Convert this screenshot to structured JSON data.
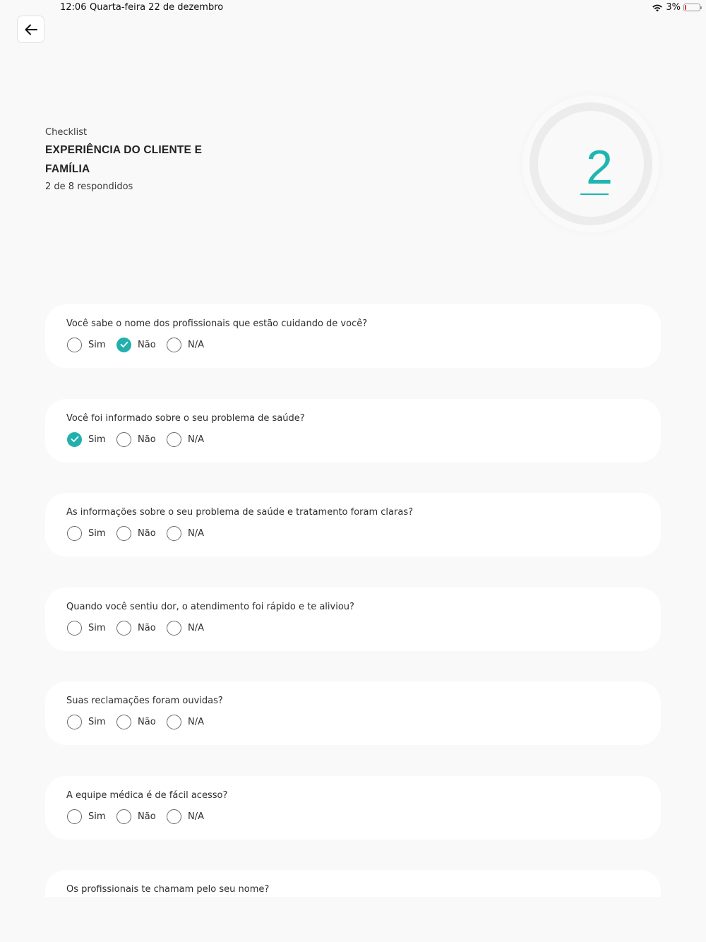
{
  "status_bar": {
    "time": "12:06",
    "date": "Quarta-feira 22 de dezembro",
    "battery_text": "3%",
    "battery_level": 0.03
  },
  "header": {
    "subtitle": "Checklist",
    "title": "EXPERIÊNCIA DO CLIENTE E FAMÍLIA",
    "progress_text": "2 de 8 respondidos"
  },
  "progress_ring": {
    "value": "2",
    "answered": 2,
    "total": 8
  },
  "colors": {
    "accent": "#23b0ad",
    "background": "#f9f9f9",
    "card": "#ffffff"
  },
  "option_labels": {
    "yes": "Sim",
    "no": "Não",
    "na": "N/A"
  },
  "questions": [
    {
      "text": "Você sabe o nome dos profissionais que estão cuidando de você?",
      "selected": "Não"
    },
    {
      "text": "Você foi informado sobre o seu problema de saúde?",
      "selected": "Sim"
    },
    {
      "text": "As informações sobre o seu problema de saúde e tratamento foram claras?",
      "selected": ""
    },
    {
      "text": "Quando você sentiu dor, o atendimento foi rápido e te aliviou?",
      "selected": ""
    },
    {
      "text": "Suas reclamações foram ouvidas?",
      "selected": ""
    },
    {
      "text": "A equipe médica é de fácil acesso?",
      "selected": ""
    },
    {
      "text": "Os profissionais te chamam pelo seu nome?",
      "selected": ""
    }
  ]
}
